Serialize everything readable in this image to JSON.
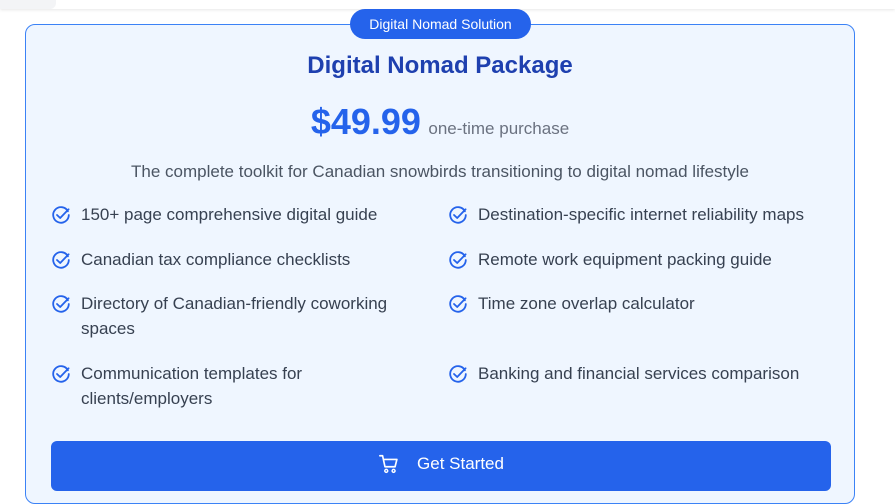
{
  "badge": "Digital Nomad Solution",
  "title": "Digital Nomad Package",
  "price": "$49.99",
  "price_note": "one-time purchase",
  "description": "The complete toolkit for Canadian snowbirds transitioning to digital nomad lifestyle",
  "features": [
    {
      "label": "150+ page comprehensive digital guide",
      "icon": "check-circle-icon"
    },
    {
      "label": "Destination-specific internet reliability maps",
      "icon": "check-circle-icon"
    },
    {
      "label": "Canadian tax compliance checklists",
      "icon": "check-circle-icon"
    },
    {
      "label": "Remote work equipment packing guide",
      "icon": "check-circle-icon"
    },
    {
      "label": "Directory of Canadian-friendly coworking spaces",
      "icon": "check-circle-icon"
    },
    {
      "label": "Time zone overlap calculator",
      "icon": "check-circle-icon"
    },
    {
      "label": "Communication templates for clients/employers",
      "icon": "check-circle-icon"
    },
    {
      "label": "Banking and financial services comparison",
      "icon": "check-circle-icon"
    }
  ],
  "cta": {
    "label": "Get Started",
    "icon": "shopping-cart-icon"
  },
  "colors": {
    "accent": "#2563eb",
    "title": "#1e40af",
    "card_background": "#eff6ff",
    "card_border": "#3b82f6"
  }
}
